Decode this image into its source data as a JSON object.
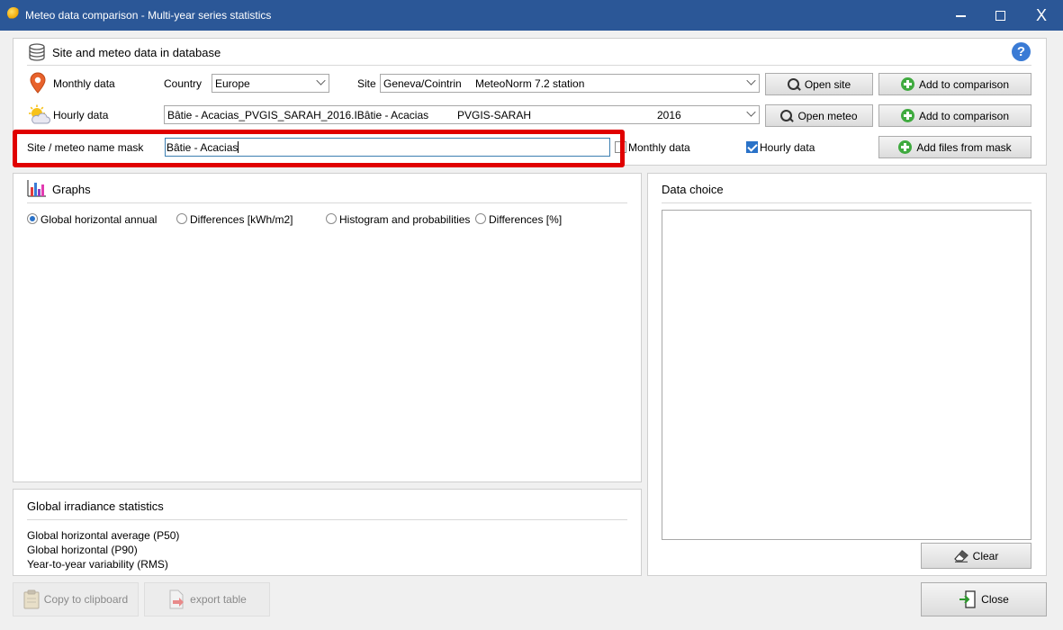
{
  "window": {
    "title": "Meteo data comparison - Multi-year series statistics",
    "minimize_glyph": "",
    "close_glyph": "X"
  },
  "site_section": {
    "header": "Site and meteo data in database",
    "monthly_label": "Monthly data",
    "country_label": "Country",
    "country_value": "Europe",
    "site_label": "Site",
    "site_value": "Geneva/Cointrin",
    "site_source": "MeteoNorm 7.2 station",
    "open_site": "Open site",
    "add_comparison_1": "Add to comparison",
    "hourly_label": "Hourly data",
    "hourly_file": "Bâtie - Acacias_PVGIS_SARAH_2016.IBâtie - Acacias",
    "hourly_source": "PVGIS-SARAH",
    "hourly_year": "2016",
    "open_meteo": "Open meteo",
    "add_comparison_2": "Add to comparison",
    "mask_label": "Site / meteo name mask",
    "mask_value": "Bâtie - Acacias",
    "monthly_check_label": "Monthly data",
    "monthly_checked": false,
    "hourly_check_label": "Hourly data",
    "hourly_checked": true,
    "add_files_mask": "Add files from mask"
  },
  "graphs": {
    "header": "Graphs",
    "options": [
      {
        "label": "Global horizontal annual",
        "selected": true
      },
      {
        "label": "Differences [kWh/m2]",
        "selected": false
      },
      {
        "label": "Histogram and probabilities",
        "selected": false
      },
      {
        "label": "Differences [%]",
        "selected": false
      }
    ]
  },
  "data_choice": {
    "header": "Data choice",
    "clear": "Clear"
  },
  "stats": {
    "header": "Global irradiance statistics",
    "rows": [
      "Global horizontal average (P50)",
      "Global horizontal (P90)",
      "Year-to-year variability (RMS)"
    ]
  },
  "footer": {
    "copy": "Copy to clipboard",
    "export": "export table",
    "close": "Close"
  },
  "colors": {
    "titlebar": "#2b5797",
    "highlight": "#e00000",
    "accent": "#2a72c8"
  }
}
